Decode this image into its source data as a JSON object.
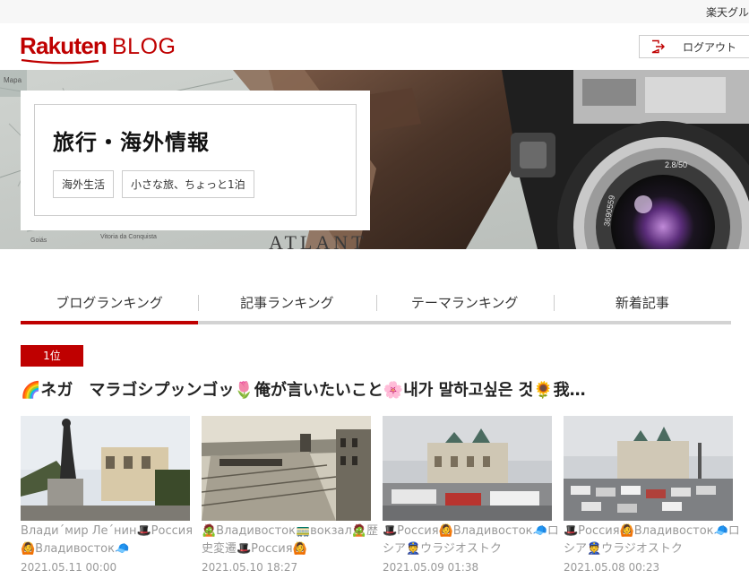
{
  "topbar": {
    "group_label": "楽天グル"
  },
  "header": {
    "logo_brand": "Rakuten",
    "logo_blog": "BLOG",
    "logout_label": "ログアウト"
  },
  "hero": {
    "title": "旅行・海外情報",
    "tags": [
      "海外生活",
      "小さな旅、ちょっと1泊"
    ],
    "map_text": [
      "ATLANT",
      "Vitoria da Conquista",
      "Goiás",
      "Mapa"
    ],
    "lens_text": [
      "2.8/50",
      "3690559"
    ]
  },
  "tabs": [
    {
      "label": "ブログランキング",
      "active": true
    },
    {
      "label": "記事ランキング",
      "active": false
    },
    {
      "label": "テーマランキング",
      "active": false
    },
    {
      "label": "新着記事",
      "active": false
    }
  ],
  "ranking": {
    "badge": "1位",
    "blog_title": "🌈ネガ　マラゴシプッンゴッ🌷俺が言いたいこと🌸내가 말하고싶은 것🌻我…"
  },
  "articles": [
    {
      "title": "Влади´мир Ле´нин🎩Россия🙆Владивосток🧢",
      "date": "2021.05.11 00:00"
    },
    {
      "title": "🧟Владивосток🚃вокзал🧟歴史変遷🎩Россия🙆",
      "date": "2021.05.10 18:27"
    },
    {
      "title": "🎩Россия🙆Владивосток🧢ロシア👮ウラジオストク",
      "date": "2021.05.09 01:38"
    },
    {
      "title": "🎩Россия🙆Владивосток🧢ロシア👮ウラジオストク",
      "date": "2021.05.08 00:23"
    }
  ],
  "colors": {
    "accent": "#bf0000",
    "tab_rule": "#d3d3d3",
    "meta_text": "#999999"
  },
  "icons": {
    "logout": "logout-icon"
  }
}
